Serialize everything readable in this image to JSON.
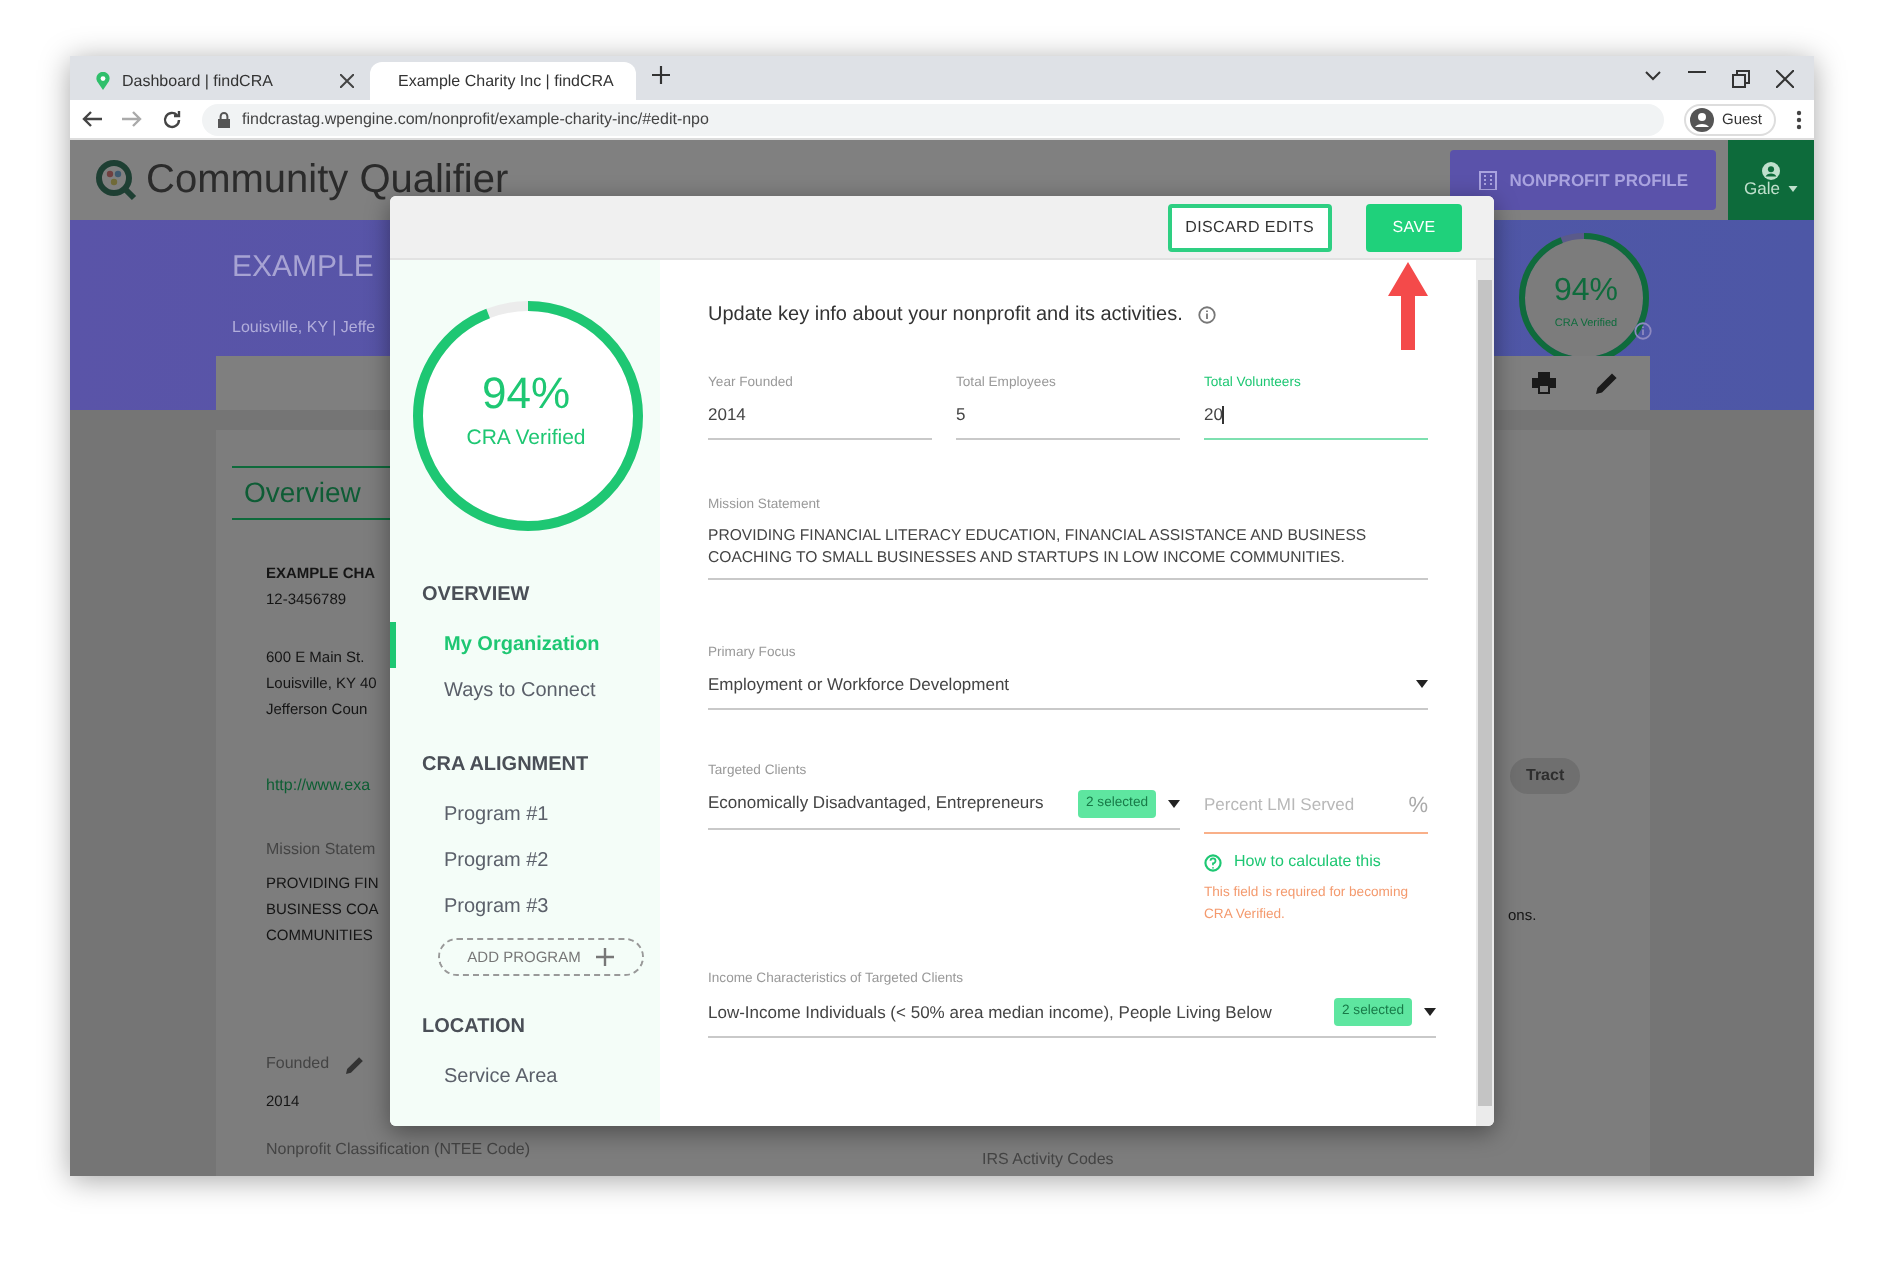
{
  "browser": {
    "tabs": [
      {
        "title": "Dashboard | findCRA",
        "selected": false
      },
      {
        "title": "Example Charity Inc | findCRA",
        "selected": true
      }
    ],
    "url": "findcrastag.wpengine.com/nonprofit/example-charity-inc/#edit-npo",
    "profile": "Guest"
  },
  "header": {
    "app_title": "Community Qualifier",
    "profile_button": "NONPROFIT PROFILE",
    "user": "Gale"
  },
  "banner": {
    "title": "EXAMPLE",
    "subtitle": "Louisville, KY | Jeffe",
    "score": {
      "percent": "94%",
      "label": "CRA Verified",
      "level": 0.94
    }
  },
  "overview": {
    "tab": "Overview",
    "name": "EXAMPLE CHA",
    "ein": "12-3456789",
    "address": [
      "600 E Main St.",
      "Louisville, KY 40",
      "Jefferson Coun"
    ],
    "website": "http://www.exa",
    "mission_label": "Mission Statem",
    "mission_lines": [
      "PROVIDING FIN",
      "BUSINESS COA",
      "COMMUNITIES"
    ],
    "founded_label": "Founded",
    "founded": "2014",
    "classification_label": "Nonprofit Classification (NTEE Code)",
    "irs_label": "IRS Activity Codes",
    "chip": "Tract",
    "note": "ons."
  },
  "modal": {
    "buttons": [
      {
        "label": "DISCARD EDITS",
        "kind": "outline"
      },
      {
        "label": "SAVE",
        "kind": "primary"
      }
    ],
    "score": {
      "percent": "94%",
      "label": "CRA Verified",
      "level": 0.94
    },
    "nav": [
      {
        "heading": "OVERVIEW",
        "items": [
          {
            "label": "My Organization",
            "selected": true
          },
          {
            "label": "Ways to Connect",
            "selected": false
          }
        ]
      },
      {
        "heading": "CRA ALIGNMENT",
        "items": [
          {
            "label": "Program #1",
            "selected": false
          },
          {
            "label": "Program #2",
            "selected": false
          },
          {
            "label": "Program #3",
            "selected": false
          }
        ],
        "add_button": "ADD PROGRAM"
      },
      {
        "heading": "LOCATION",
        "items": [
          {
            "label": "Service Area",
            "selected": false
          }
        ]
      }
    ],
    "intro": "Update key info about your nonprofit and its activities.",
    "groups": [
      {
        "fields": [
          {
            "kind": "text",
            "label": "Year Founded",
            "value": "2014",
            "focused": false,
            "invalid": false
          },
          {
            "kind": "text",
            "label": "Total Employees",
            "value": "5",
            "focused": false,
            "invalid": false
          },
          {
            "kind": "text",
            "label": "Total Volunteers",
            "value": "20",
            "focused": true,
            "invalid": false
          }
        ]
      },
      {
        "fields": [
          {
            "kind": "textarea",
            "label": "Mission Statement",
            "value": "PROVIDING FINANCIAL LITERACY EDUCATION, FINANCIAL ASSISTANCE AND BUSINESS COACHING TO SMALL BUSINESSES AND STARTUPS IN LOW INCOME COMMUNITIES.",
            "focused": false,
            "invalid": false
          }
        ]
      },
      {
        "fields": [
          {
            "kind": "select",
            "label": "Primary Focus",
            "value": "Employment or Workforce Development",
            "focused": false,
            "invalid": false
          }
        ]
      },
      {
        "fields": [
          {
            "kind": "multiselect",
            "label": "Targeted Clients",
            "value": "Economically Disadvantaged, Entrepreneurs",
            "badge": "2 selected",
            "focused": false,
            "invalid": false
          },
          {
            "kind": "percent",
            "placeholder": "Percent LMI Served",
            "suffix": "%",
            "focused": false,
            "invalid": true,
            "help": "How to calculate this",
            "error": "This field is required for becoming CRA Verified."
          }
        ]
      },
      {
        "fields": [
          {
            "kind": "multiselect",
            "label": "Income Characteristics of Targeted Clients",
            "value": "Low-Income Individuals (< 50% area median income), People Living Below",
            "badge": "2 selected",
            "focused": false,
            "invalid": false
          }
        ]
      }
    ]
  }
}
